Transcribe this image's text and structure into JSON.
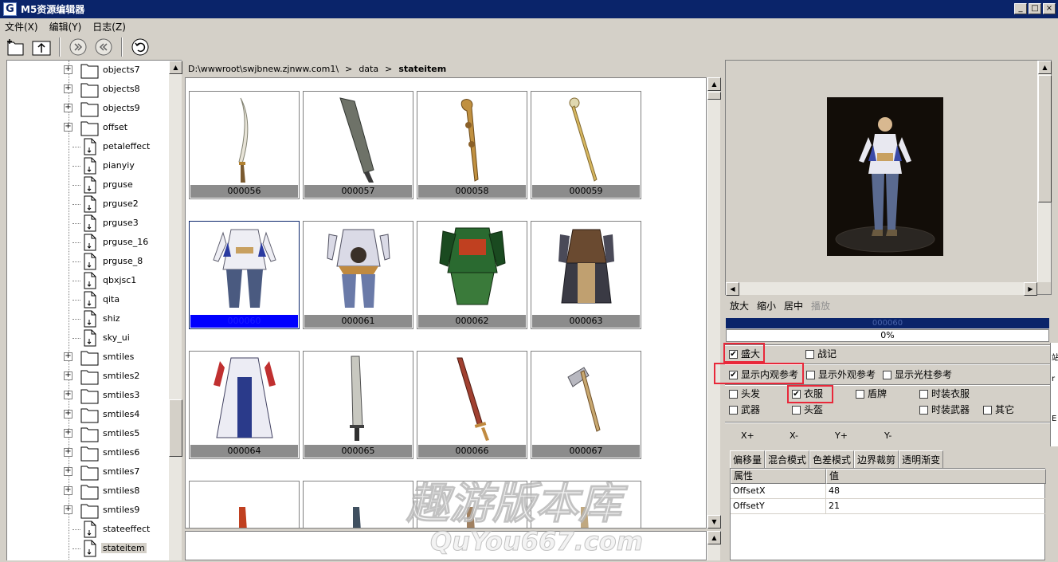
{
  "window": {
    "icon_letter": "G",
    "title": "M5资源编辑器",
    "min": "_",
    "max": "□",
    "close": "×"
  },
  "menu": [
    "文件(X)",
    "编辑(Y)",
    "日志(Z)"
  ],
  "tree": {
    "items": [
      {
        "label": "objects7",
        "folder": true
      },
      {
        "label": "objects8",
        "folder": true
      },
      {
        "label": "objects9",
        "folder": true
      },
      {
        "label": "offset",
        "folder": true
      },
      {
        "label": "petaleffect",
        "folder": false
      },
      {
        "label": "pianyiy",
        "folder": false
      },
      {
        "label": "prguse",
        "folder": false
      },
      {
        "label": "prguse2",
        "folder": false
      },
      {
        "label": "prguse3",
        "folder": false
      },
      {
        "label": "prguse_16",
        "folder": false
      },
      {
        "label": "prguse_8",
        "folder": false
      },
      {
        "label": "qbxjsc1",
        "folder": false
      },
      {
        "label": "qita",
        "folder": false
      },
      {
        "label": "shiz",
        "folder": false
      },
      {
        "label": "sky_ui",
        "folder": false
      },
      {
        "label": "smtiles",
        "folder": true
      },
      {
        "label": "smtiles2",
        "folder": true
      },
      {
        "label": "smtiles3",
        "folder": true
      },
      {
        "label": "smtiles4",
        "folder": true
      },
      {
        "label": "smtiles5",
        "folder": true
      },
      {
        "label": "smtiles6",
        "folder": true
      },
      {
        "label": "smtiles7",
        "folder": true
      },
      {
        "label": "smtiles8",
        "folder": true
      },
      {
        "label": "smtiles9",
        "folder": true
      },
      {
        "label": "stateeffect",
        "folder": false
      },
      {
        "label": "stateitem",
        "folder": false,
        "selected": true
      }
    ]
  },
  "path": {
    "root": "D:\\wwwroot\\swjbnew.zjnww.com1\\",
    "sep": ">",
    "mid": "data",
    "current": "stateitem"
  },
  "grid": {
    "items": [
      {
        "label": "000056",
        "kind": "sword"
      },
      {
        "label": "000057",
        "kind": "blade"
      },
      {
        "label": "000058",
        "kind": "staff"
      },
      {
        "label": "000059",
        "kind": "staff2"
      },
      {
        "label": "000060",
        "kind": "robe-white",
        "selected": true
      },
      {
        "label": "000061",
        "kind": "armor-brown"
      },
      {
        "label": "000062",
        "kind": "armor-green"
      },
      {
        "label": "000063",
        "kind": "armor-dark"
      },
      {
        "label": "000064",
        "kind": "robe-long"
      },
      {
        "label": "000065",
        "kind": "greatsword"
      },
      {
        "label": "000066",
        "kind": "redsword"
      },
      {
        "label": "000067",
        "kind": "axe"
      }
    ]
  },
  "preview": {
    "zoom_in": "放大",
    "zoom_out": "缩小",
    "center": "居中",
    "play": "播放"
  },
  "progress": {
    "label": "000060",
    "percent_text": "0%",
    "value": 0
  },
  "checks": {
    "shengda": {
      "label": "盛大",
      "checked": true
    },
    "zhanji": {
      "label": "战记",
      "checked": false
    },
    "show_inner": {
      "label": "显示内观参考",
      "checked": true
    },
    "show_outer": {
      "label": "显示外观参考",
      "checked": false
    },
    "show_pillar": {
      "label": "显示光柱参考",
      "checked": false
    },
    "hair": {
      "label": "头发",
      "checked": false
    },
    "clothes": {
      "label": "衣服",
      "checked": true
    },
    "shield": {
      "label": "盾牌",
      "checked": false
    },
    "fashion_clothes": {
      "label": "时装衣服",
      "checked": false
    },
    "weapon": {
      "label": "武器",
      "checked": false
    },
    "helmet": {
      "label": "头盔",
      "checked": false
    },
    "fashion_weapon": {
      "label": "时装武器",
      "checked": false
    },
    "other": {
      "label": "其它",
      "checked": false
    }
  },
  "offset_buttons": [
    "X+",
    "X-",
    "Y+",
    "Y-"
  ],
  "tabs": [
    "偏移量",
    "混合模式",
    "色差模式",
    "边界裁剪",
    "透明渐变"
  ],
  "props": {
    "headers": [
      "属性",
      "值"
    ],
    "rows": [
      {
        "name": "OffsetX",
        "value": "48"
      },
      {
        "name": "OffsetY",
        "value": "21"
      }
    ]
  },
  "side_clip": [
    "站",
    "r",
    "E"
  ],
  "watermark": {
    "line1": "趣游版本库",
    "line2": "QuYou667.com"
  },
  "colors": {
    "titlebar": "#0a246a",
    "highlight": "#e8283a",
    "selection": "#0000ff"
  }
}
